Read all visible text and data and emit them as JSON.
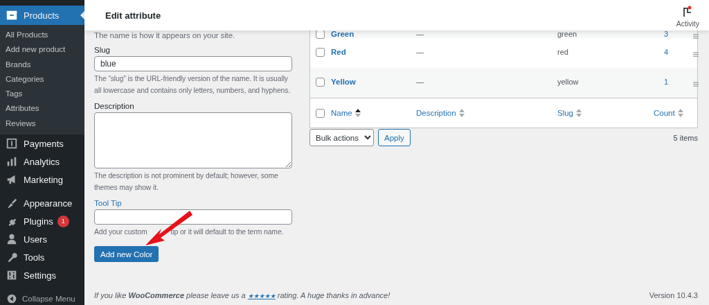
{
  "sidebar": {
    "groups": [
      {
        "items": [
          {
            "label": "Products",
            "selected": true,
            "submenu": [
              {
                "label": "All Products",
                "selected": false
              },
              {
                "label": "Add new product",
                "selected": false
              },
              {
                "label": "Brands",
                "selected": false
              },
              {
                "label": "Categories",
                "selected": false
              },
              {
                "label": "Tags",
                "selected": false
              },
              {
                "label": "Attributes",
                "selected": false
              },
              {
                "label": "Reviews",
                "selected": false
              }
            ]
          },
          {
            "label": "Payments",
            "selected": false
          },
          {
            "label": "Analytics",
            "selected": false
          },
          {
            "label": "Marketing",
            "selected": false
          }
        ]
      },
      {
        "items": [
          {
            "label": "Appearance",
            "selected": false
          },
          {
            "label": "Plugins",
            "selected": false,
            "badge": "1"
          },
          {
            "label": "Users",
            "selected": false
          },
          {
            "label": "Tools",
            "selected": false
          },
          {
            "label": "Settings",
            "selected": false
          }
        ]
      }
    ],
    "collapse": "Collapse Menu"
  },
  "header": {
    "title": "Edit attribute",
    "activity": "Activity"
  },
  "form": {
    "intro": "The name is how it appears on your site.",
    "fields": [
      {
        "kind": "input",
        "label": "Slug",
        "value": "blue",
        "help": "The “slug” is the URL-friendly version of the name. It is usually all lowercase and contains only letters, numbers, and hyphens."
      },
      {
        "kind": "textarea",
        "label": "Description",
        "help": "The description is not prominent by default; however, some themes may show it."
      },
      {
        "kind": "input",
        "label": "Tool Tip",
        "link_label": true,
        "help": "Add your custom",
        "help_after": "tip or it will default to the term name."
      }
    ],
    "submit": "Add new Color"
  },
  "table": {
    "rows": [
      {
        "name": "Green",
        "description": "—",
        "slug": "green",
        "count": "3",
        "selected": false
      },
      {
        "name": "Red",
        "description": "—",
        "slug": "red",
        "count": "4",
        "selected": false
      },
      {
        "name": "Yellow",
        "description": "—",
        "slug": "yellow",
        "count": "1",
        "selected": false
      }
    ],
    "columns": [
      {
        "label": "Name",
        "sorted": true
      },
      {
        "label": "Description",
        "sorted": false
      },
      {
        "label": "Slug",
        "sorted": false
      },
      {
        "label": "Count",
        "sorted": false
      }
    ],
    "footer_selected": false,
    "bulk_actions": "Bulk actions",
    "apply": "Apply",
    "items_count": "5 items"
  },
  "footer": {
    "before": "If you like **WooCommerce** please leave us a",
    "link": "★★★★★",
    "after": "rating. A huge thanks in advance!",
    "version": "Version 10.4.3"
  }
}
